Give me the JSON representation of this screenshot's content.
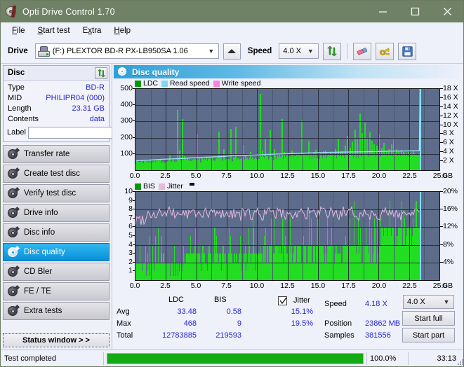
{
  "window": {
    "title": "Opti Drive Control 1.70",
    "icon": "disc-icon",
    "minimize": "minimize",
    "maximize": "maximize",
    "close": "close"
  },
  "menu": [
    {
      "label": "File",
      "accel": "F"
    },
    {
      "label": "Start test",
      "accel": "S"
    },
    {
      "label": "Extra",
      "accel": "x"
    },
    {
      "label": "Help",
      "accel": "H"
    }
  ],
  "toolbar": {
    "drive_label": "Drive",
    "drive_value": "(F:)  PLEXTOR BD-R  PX-LB950SA 1.06",
    "eject": "Eject",
    "speed_label": "Speed",
    "speed_value": "4.0 X",
    "refresh": "refresh-icon",
    "erase": "eraser-icon",
    "keys": "keys-icon",
    "save": "save-icon"
  },
  "sidebar": {
    "disc_panel": {
      "title": "Disc",
      "refresh_button": "refresh",
      "rows": [
        {
          "key": "Type",
          "value": "BD-R"
        },
        {
          "key": "MID",
          "value": "PHILIPR04 (000)"
        },
        {
          "key": "Length",
          "value": "23.31 GB"
        },
        {
          "key": "Contents",
          "value": "data"
        }
      ],
      "label_key": "Label",
      "label_value": "",
      "label_placeholder": ""
    },
    "nav": [
      {
        "label": "Transfer rate",
        "active": false
      },
      {
        "label": "Create test disc",
        "active": false
      },
      {
        "label": "Verify test disc",
        "active": false
      },
      {
        "label": "Drive info",
        "active": false
      },
      {
        "label": "Disc info",
        "active": false
      },
      {
        "label": "Disc quality",
        "active": true
      },
      {
        "label": "CD Bler",
        "active": false
      },
      {
        "label": "FE / TE",
        "active": false
      },
      {
        "label": "Extra tests",
        "active": false
      }
    ],
    "status_window_button": "Status window > >"
  },
  "panel": {
    "title": "Disc quality"
  },
  "stats": {
    "col_ldc": "LDC",
    "col_bis": "BIS",
    "row_avg": "Avg",
    "row_max": "Max",
    "row_total": "Total",
    "ldc_avg": "33.48",
    "ldc_max": "468",
    "ldc_total": "12783885",
    "bis_avg": "0.58",
    "bis_max": "9",
    "bis_total": "219593",
    "jitter_label": "Jitter",
    "jitter_checked": true,
    "jitter_avg": "15.1%",
    "jitter_max": "19.5%",
    "speed_label": "Speed",
    "speed_value": "4.18 X",
    "position_label": "Position",
    "position_value": "23862 MB",
    "samples_label": "Samples",
    "samples_value": "381556",
    "speed_select": "4.0 X",
    "start_full": "Start full",
    "start_part": "Start part"
  },
  "statusbar": {
    "text": "Test completed",
    "progress_percent": 100.0,
    "progress_label": "100.0%",
    "time": "33:13"
  },
  "colors": {
    "titlebar": "#6f8266",
    "accent_blue": "#0a8fd8",
    "value_blue": "#2727d8",
    "plot_bg": "#5d6c8b",
    "ldc_green": "#22dd22",
    "bis_green": "#22dd22",
    "read_speed": "#7fe0f8",
    "write_speed": "#ff80e0",
    "jitter_pink": "#e6b8dc",
    "progress_green": "#13aa13"
  },
  "chart_data": [
    {
      "type": "bar",
      "name": "top-chart",
      "title": "",
      "legend": [
        {
          "label": "LDC",
          "color": "#009900"
        },
        {
          "label": "Read speed",
          "color": "#7fd8f0"
        },
        {
          "label": "Write speed",
          "color": "#ff80e0"
        }
      ],
      "legend_position": "top-left",
      "xlabel": "GB",
      "xlim": [
        0,
        25
      ],
      "xticks": [
        0.0,
        2.5,
        5.0,
        7.5,
        10.0,
        12.5,
        15.0,
        17.5,
        20.0,
        22.5,
        25.0
      ],
      "xticklabels": [
        "0.0",
        "2.5",
        "5.0",
        "7.5",
        "10.0",
        "12.5",
        "15.0",
        "17.5",
        "20.0",
        "22.5",
        "25.0"
      ],
      "ylabel": "",
      "ylim": [
        0,
        500
      ],
      "yticks": [
        100,
        200,
        300,
        400,
        500
      ],
      "yticklabels": [
        "100",
        "200",
        "300",
        "400",
        "500"
      ],
      "y2label": "",
      "y2lim": [
        0,
        18
      ],
      "y2ticks": [
        2,
        4,
        6,
        8,
        10,
        12,
        14,
        16,
        18
      ],
      "y2ticklabels": [
        "2 X",
        "4 X",
        "6 X",
        "8 X",
        "10 X",
        "12 X",
        "14 X",
        "16 X",
        "18 X"
      ],
      "grid": true,
      "data_end_gb": 23.4,
      "series": [
        {
          "name": "LDC",
          "color": "#22dd22",
          "type": "bar",
          "x": [
            0.05,
            0.2,
            0.4,
            0.6,
            0.8,
            1.0,
            1.2,
            1.4,
            1.6,
            1.8,
            2.0,
            2.2,
            2.4,
            2.6,
            2.8,
            3.0,
            3.2,
            3.4,
            3.6,
            3.8,
            4.0,
            4.2,
            4.4,
            4.6,
            4.8,
            5.0,
            5.2,
            5.4,
            5.6,
            5.8,
            6.0,
            6.2,
            6.4,
            6.6,
            6.8,
            7.0,
            7.2,
            7.4,
            7.6,
            7.8,
            8.0,
            8.2,
            8.4,
            8.6,
            8.8,
            9.0,
            9.2,
            9.4,
            9.6,
            9.8,
            10.0,
            10.2,
            10.4,
            10.6,
            10.8,
            11.0,
            11.2,
            11.4,
            11.6,
            11.8,
            12.0,
            12.2,
            12.4,
            12.6,
            12.8,
            13.0,
            13.2,
            13.4,
            13.6,
            13.8,
            14.0,
            14.2,
            14.4,
            14.6,
            14.8,
            15.0,
            15.2,
            15.4,
            15.6,
            15.8,
            16.0,
            16.2,
            16.4,
            16.6,
            16.8,
            17.0,
            17.2,
            17.4,
            17.6,
            17.8,
            18.0,
            18.2,
            18.4,
            18.6,
            18.8,
            19.0,
            19.2,
            19.4,
            19.6,
            19.8,
            20.0,
            20.2,
            20.4,
            20.6,
            20.8,
            21.0,
            21.2,
            21.4,
            21.6,
            21.8,
            22.0,
            22.2,
            22.4,
            22.6,
            22.8,
            23.0,
            23.2,
            23.35
          ],
          "values": [
            60,
            52,
            48,
            45,
            55,
            47,
            44,
            50,
            46,
            43,
            48,
            52,
            46,
            44,
            90,
            62,
            50,
            370,
            120,
            315,
            88,
            70,
            55,
            60,
            58,
            220,
            72,
            64,
            68,
            60,
            66,
            62,
            58,
            70,
            235,
            92,
            130,
            65,
            70,
            255,
            80,
            268,
            75,
            70,
            155,
            95,
            68,
            110,
            80,
            78,
            190,
            470,
            120,
            200,
            88,
            245,
            80,
            130,
            92,
            95,
            315,
            110,
            100,
            85,
            120,
            90,
            98,
            95,
            305,
            105,
            100,
            180,
            95,
            110,
            125,
            100,
            105,
            115,
            120,
            100,
            110,
            105,
            130,
            195,
            115,
            120,
            150,
            210,
            140,
            175,
            250,
            190,
            350,
            230,
            295,
            200,
            235,
            180,
            160,
            150,
            220,
            140,
            170,
            120,
            130,
            160,
            200,
            130,
            118,
            125,
            110,
            105,
            112,
            108,
            120
          ]
        },
        {
          "name": "Read speed",
          "color": "#9ee0f8",
          "type": "line",
          "axis": "right",
          "x": [
            0.05,
            1.0,
            2.0,
            3.0,
            4.0,
            5.0,
            6.0,
            7.0,
            8.0,
            9.0,
            10.0,
            11.0,
            12.0,
            13.0,
            14.0,
            15.0,
            16.0,
            17.0,
            18.0,
            19.0,
            20.0,
            21.0,
            22.0,
            23.0,
            23.35,
            23.4
          ],
          "values": [
            2.1,
            2.2,
            2.4,
            2.5,
            2.6,
            2.8,
            2.9,
            3.0,
            3.2,
            3.3,
            3.4,
            3.5,
            3.6,
            3.7,
            3.8,
            3.9,
            3.95,
            4.0,
            4.05,
            4.1,
            4.15,
            4.2,
            4.25,
            4.3,
            4.3,
            18.0
          ]
        },
        {
          "name": "Write speed",
          "color": "#ff80e0",
          "type": "line",
          "axis": "right",
          "x": [],
          "values": []
        }
      ]
    },
    {
      "type": "bar",
      "name": "bottom-chart",
      "title": "",
      "legend": [
        {
          "label": "BIS",
          "color": "#009900"
        },
        {
          "label": "Jitter",
          "color": "#e6b8dc"
        }
      ],
      "legend_position": "top-left",
      "xlabel": "GB",
      "xlim": [
        0,
        25
      ],
      "xticks": [
        0.0,
        2.5,
        5.0,
        7.5,
        10.0,
        12.5,
        15.0,
        17.5,
        20.0,
        22.5,
        25.0
      ],
      "xticklabels": [
        "0.0",
        "2.5",
        "5.0",
        "7.5",
        "10.0",
        "12.5",
        "15.0",
        "17.5",
        "20.0",
        "22.5",
        "25.0"
      ],
      "ylim": [
        0,
        10
      ],
      "yticks": [
        1,
        2,
        3,
        4,
        5,
        6,
        7,
        8,
        9,
        10
      ],
      "yticklabels": [
        "1",
        "2",
        "3",
        "4",
        "5",
        "6",
        "7",
        "8",
        "9",
        "10"
      ],
      "y2lim": [
        0,
        20
      ],
      "y2ticks": [
        4,
        8,
        12,
        16,
        20
      ],
      "y2ticklabels": [
        "4%",
        "8%",
        "12%",
        "16%",
        "20%"
      ],
      "grid": true,
      "data_end_gb": 23.4,
      "series": [
        {
          "name": "BIS",
          "color": "#22dd22",
          "type": "bar",
          "baseline_segments": [
            {
              "from": 0.0,
              "to": 3.9,
              "base": 2
            },
            {
              "from": 3.9,
              "to": 10.4,
              "base": 3
            },
            {
              "from": 10.4,
              "to": 20.1,
              "base": 4
            },
            {
              "from": 20.1,
              "to": 23.4,
              "base": 6
            }
          ],
          "peaks_note": "frequent spikes to 3-9 increasing toward outer radius"
        },
        {
          "name": "Jitter",
          "color": "#e6b8dc",
          "type": "line",
          "axis": "right",
          "mean_percent": 15.1,
          "max_percent": 19.5,
          "range_percent": [
            12.5,
            19.5
          ]
        }
      ]
    }
  ]
}
